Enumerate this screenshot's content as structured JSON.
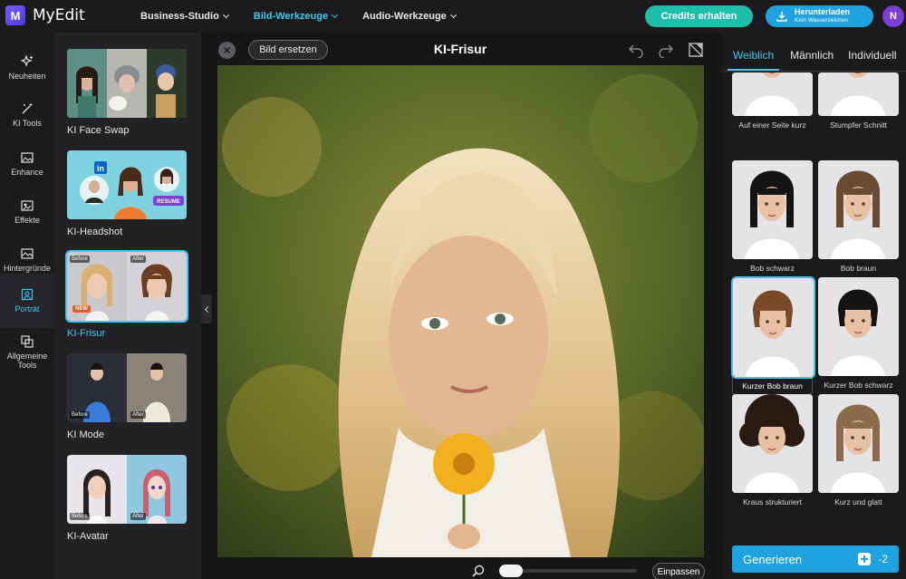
{
  "app": {
    "name": "MyEdit",
    "logo_letter": "M",
    "user_initial": "N"
  },
  "topnav": {
    "items": [
      {
        "label": "Business-Studio",
        "active": false
      },
      {
        "label": "Bild-Werkzeuge",
        "active": true
      },
      {
        "label": "Audio-Werkzeuge",
        "active": false
      }
    ],
    "credits_label": "Credits erhalten",
    "download_label": "Herunterladen",
    "download_sub": "Kein Wasserzeichen"
  },
  "iconbar": {
    "items": [
      {
        "label": "Neuheiten",
        "icon": "sparkle-icon"
      },
      {
        "label": "KI Tools",
        "icon": "magic-wand-icon"
      },
      {
        "label": "Enhance",
        "icon": "image-enhance-icon"
      },
      {
        "label": "Effekte",
        "icon": "effects-icon"
      },
      {
        "label": "Hintergründe",
        "icon": "background-icon"
      },
      {
        "label": "Porträt",
        "icon": "portrait-icon",
        "active": true
      },
      {
        "label": "Allgemeine Tools",
        "icon": "tools-icon"
      }
    ]
  },
  "tools": {
    "items": [
      {
        "label": "KI Face Swap"
      },
      {
        "label": "KI-Headshot"
      },
      {
        "label": "KI-Frisur",
        "active": true,
        "before": "Before",
        "after": "After",
        "badge": "NEW"
      },
      {
        "label": "KI Mode",
        "before": "Before",
        "after": "After"
      },
      {
        "label": "KI-Avatar",
        "before": "Before",
        "after": "After"
      }
    ],
    "headshot_badges": {
      "linkedin": "in",
      "resume": "RESUME"
    }
  },
  "canvas": {
    "replace_label": "Bild ersetzen",
    "title": "KI-Frisur",
    "fit_label": "Einpassen",
    "zoom_percent": 8
  },
  "styles": {
    "tabs": [
      {
        "label": "Weiblich",
        "active": true
      },
      {
        "label": "Männlich"
      },
      {
        "label": "Individuell"
      }
    ],
    "items": [
      {
        "label": "Auf einer Seite kurz",
        "hair": "#6b4a2e"
      },
      {
        "label": "Stumpfer Schnitt",
        "hair": "#1d1a18"
      },
      {
        "label": "Bob schwarz",
        "hair": "#161412"
      },
      {
        "label": "Bob braun",
        "hair": "#6a4a30"
      },
      {
        "label": "Kurzer Bob braun",
        "hair": "#7a4a28",
        "active": true
      },
      {
        "label": "Kurzer Bob schwarz",
        "hair": "#141414"
      },
      {
        "label": "Kraus strukturiert",
        "hair": "#2b1a12"
      },
      {
        "label": "Kurz und glatt",
        "hair": "#8a6a48"
      }
    ],
    "generate_label": "Generieren",
    "generate_cost": "-2"
  },
  "colors": {
    "accent": "#3fc7ee",
    "credits": "#1dbfa8",
    "download": "#1fa3e0"
  }
}
